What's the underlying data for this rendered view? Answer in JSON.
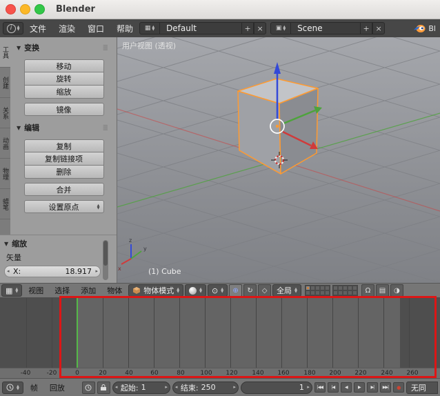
{
  "window": {
    "title": "Blender"
  },
  "info_bar": {
    "menus": [
      "文件",
      "渲染",
      "窗口",
      "帮助"
    ],
    "layout": {
      "value": "Default"
    },
    "scene": {
      "value": "Scene"
    },
    "version_text": "Bl"
  },
  "tool_shelf": {
    "tabs": [
      {
        "label": "工具",
        "active": true
      },
      {
        "label": "创建",
        "active": false
      },
      {
        "label": "关系",
        "active": false
      },
      {
        "label": "动画",
        "active": false
      },
      {
        "label": "物理",
        "active": false
      },
      {
        "label": "蜡笔",
        "active": false
      }
    ],
    "transform_panel": {
      "title": "变换",
      "buttons": [
        "移动",
        "旋转",
        "缩放",
        "镜像"
      ]
    },
    "edit_panel": {
      "title": "编辑",
      "group1": [
        "复制",
        "复制链接项",
        "删除"
      ],
      "group2": [
        "合并"
      ],
      "dropdown": "设置原点"
    },
    "redo_panel": {
      "title": "缩放",
      "vector_label": "矢量",
      "x_label": "X:",
      "x_value": "18.917"
    }
  },
  "viewport": {
    "view_label": "用户视图 (透视)",
    "object_label": "(1) Cube",
    "axis": {
      "x": "x",
      "y": "y",
      "z": "z"
    }
  },
  "viewport_header": {
    "menus": [
      "视图",
      "选择",
      "添加",
      "物体"
    ],
    "mode": "物体模式",
    "orientation": "全局"
  },
  "timeline": {
    "ticks": [
      "-40",
      "-20",
      "0",
      "20",
      "40",
      "60",
      "80",
      "100",
      "120",
      "140",
      "160",
      "180",
      "200",
      "220",
      "240",
      "260"
    ]
  },
  "timeline_header": {
    "menus": [
      "帧",
      "回放"
    ],
    "start": {
      "label": "起始:",
      "value": "1"
    },
    "end": {
      "label": "结束:",
      "value": "250"
    },
    "current": {
      "value": "1"
    },
    "playback_glyphs": [
      "|◀◀",
      "|◀",
      "◀",
      "▶",
      "▶|",
      "▶▶|"
    ],
    "sync": "无同"
  },
  "colors": {
    "selection_outline": "#ff9a30",
    "current_frame": "#55b949",
    "annotation": "#dd1616",
    "axis_x": "#d03b3b",
    "axis_y": "#4ea33c",
    "axis_z": "#3349d8"
  }
}
